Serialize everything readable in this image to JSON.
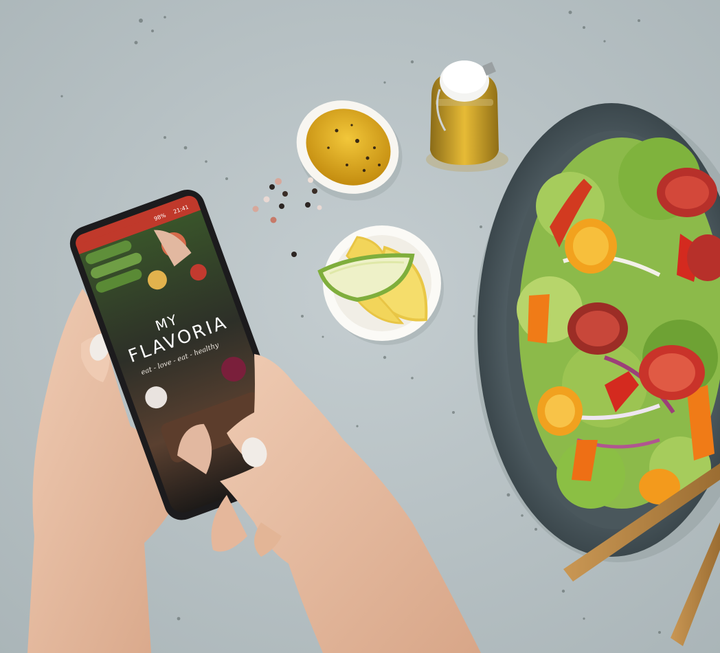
{
  "phone": {
    "status_bar": {
      "battery": "98%",
      "time": "21:41"
    },
    "app": {
      "name_line1": "MY",
      "name_line2": "FLAVORIA",
      "tagline": "eat - love - eat - healthy"
    }
  },
  "colors": {
    "tabletop": "#b9c3c6",
    "phone_status_bar": "#c0392b",
    "olive_oil": "#d6a21b",
    "lemon": "#f2d55a",
    "lime_rind": "#7fae3c",
    "bowl": "#4c5a60",
    "tomato": "#c9332a",
    "orange_pepper": "#f07b17",
    "lettuce": "#7fb33d",
    "skin": "#e7bda3",
    "chopsticks": "#b98746"
  },
  "objects": [
    "smartphone",
    "hands",
    "oil-dish",
    "oil-jar",
    "lemon-bowl",
    "salad-bowl",
    "chopsticks",
    "peppercorns"
  ]
}
